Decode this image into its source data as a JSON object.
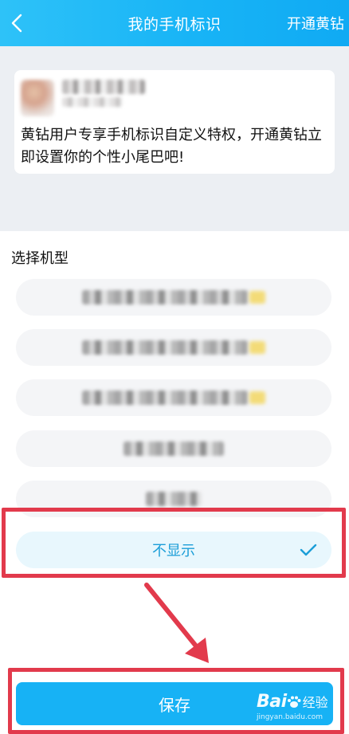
{
  "header": {
    "title": "我的手机标识",
    "action_label": "开通黄钻"
  },
  "card": {
    "text": "黄钻用户专享手机标识自定义特权，开通黄钻立即设置你的个性小尾巴吧!"
  },
  "section": {
    "label": "选择机型"
  },
  "options": [
    {
      "label": "",
      "blurred": true
    },
    {
      "label": "",
      "blurred": true
    },
    {
      "label": "",
      "blurred": true
    },
    {
      "label": "",
      "blurred": true
    },
    {
      "label": "",
      "blurred": true
    },
    {
      "label": "不显示",
      "selected": true
    }
  ],
  "footer": {
    "save_label": "保存"
  },
  "watermark": {
    "logo": "Bai",
    "logo_suffix": "经验",
    "url": "jingyan.baidu.com"
  },
  "colors": {
    "header": "#18b4f6",
    "accent": "#1b9ed8",
    "highlight": "#e23a4c",
    "save": "#17b2f5"
  }
}
